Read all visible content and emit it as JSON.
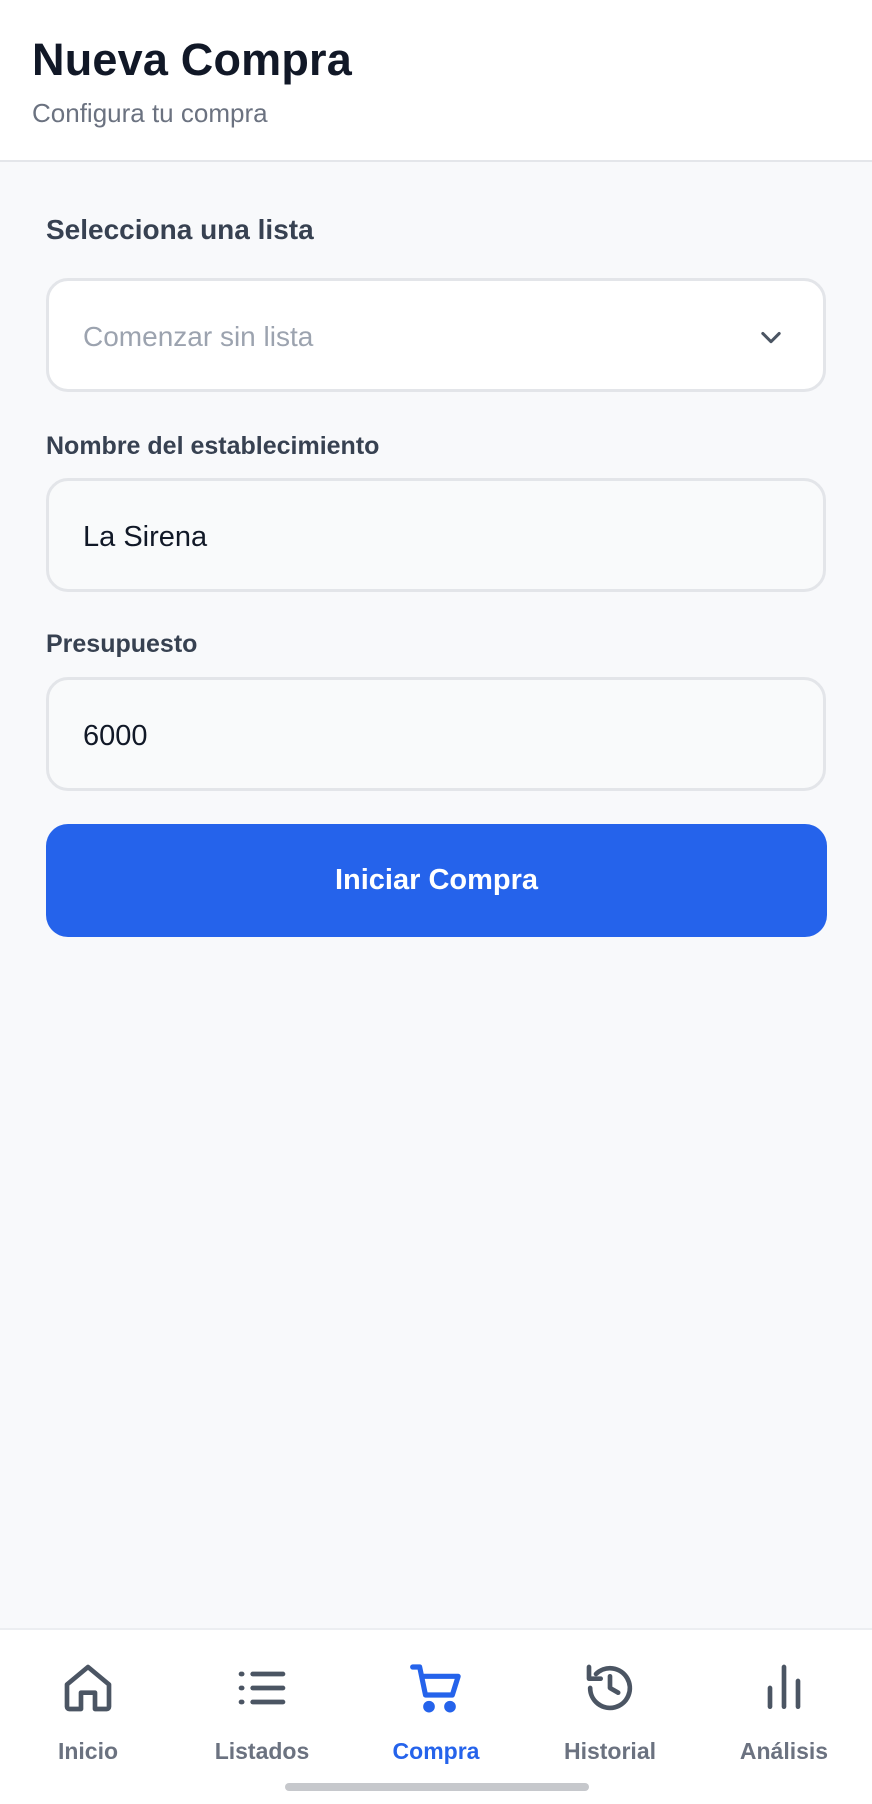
{
  "header": {
    "title": "Nueva Compra",
    "subtitle": "Configura tu compra"
  },
  "form": {
    "list_section_title": "Selecciona una lista",
    "list_select": {
      "value": "Comenzar sin lista",
      "icon": "chevron-down-icon"
    },
    "store_label": "Nombre del establecimiento",
    "store_value": "La Sirena",
    "budget_label": "Presupuesto",
    "budget_value": "6000",
    "start_button_label": "Iniciar Compra"
  },
  "bottom_nav": {
    "items": [
      {
        "label": "Inicio",
        "icon": "home-icon",
        "active": false
      },
      {
        "label": "Listados",
        "icon": "list-icon",
        "active": false
      },
      {
        "label": "Compra",
        "icon": "cart-icon",
        "active": true
      },
      {
        "label": "Historial",
        "icon": "history-icon",
        "active": false
      },
      {
        "label": "Análisis",
        "icon": "bar-chart-icon",
        "active": false
      }
    ]
  },
  "colors": {
    "accent": "#2563eb",
    "background": "#f8f9fb",
    "text_primary": "#111827",
    "text_muted": "#6b7280"
  }
}
